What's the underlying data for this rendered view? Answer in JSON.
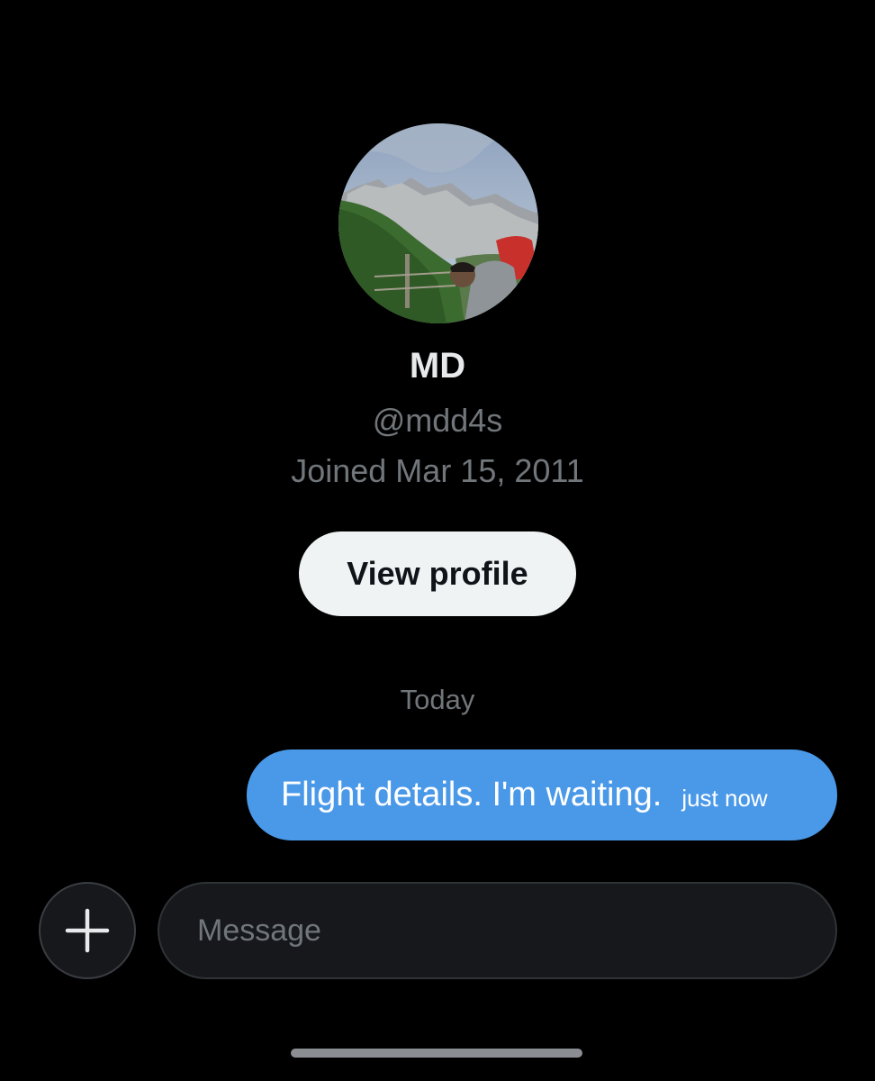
{
  "profile": {
    "name": "MD",
    "handle": "@mdd4s",
    "joined": "Joined Mar 15, 2011",
    "view_profile_label": "View profile"
  },
  "conversation": {
    "day_separator": "Today",
    "messages": [
      {
        "text": "Flight details. I'm waiting.",
        "time": "just now",
        "direction": "outgoing"
      }
    ]
  },
  "composer": {
    "placeholder": "Message",
    "add_icon": "plus-icon"
  },
  "colors": {
    "background": "#000000",
    "bubble": "#4a99e9",
    "secondary_text": "#71767b",
    "button_bg": "#eff3f4"
  }
}
